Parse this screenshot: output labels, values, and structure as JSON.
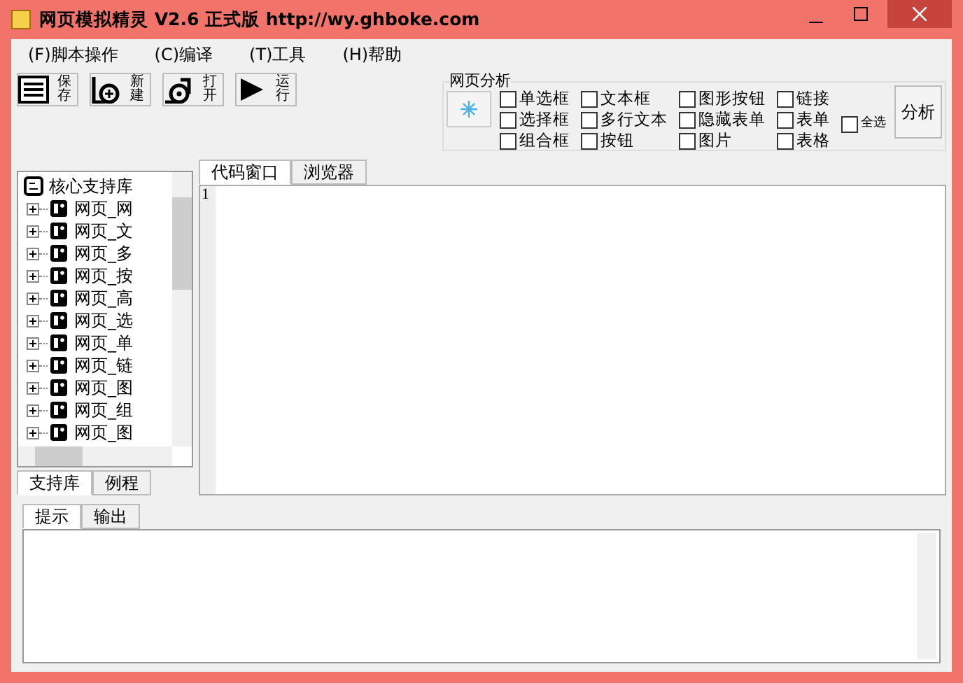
{
  "window": {
    "title": "网页模拟精灵  V2.6 正式版  http://wy.ghboke.com"
  },
  "menu": [
    "(F)脚本操作",
    "(C)编译",
    "(T)工具",
    "(H)帮助"
  ],
  "toolbar": [
    {
      "kind": "save",
      "label": "保存"
    },
    {
      "kind": "new",
      "label": "新建"
    },
    {
      "kind": "open",
      "label": "打开"
    },
    {
      "kind": "run",
      "label": "运行"
    }
  ],
  "analysis": {
    "title": "网页分析",
    "checkboxes": [
      {
        "label": "单选框",
        "checked": false
      },
      {
        "label": "选择框",
        "checked": false
      },
      {
        "label": "组合框",
        "checked": false
      },
      {
        "label": "文本框",
        "checked": false
      },
      {
        "label": "多行文本",
        "checked": false
      },
      {
        "label": "按钮",
        "checked": false
      },
      {
        "label": "图形按钮",
        "checked": false
      },
      {
        "label": "隐藏表单",
        "checked": false
      },
      {
        "label": "图片",
        "checked": false
      },
      {
        "label": "链接",
        "checked": false
      },
      {
        "label": "表单",
        "checked": false
      },
      {
        "label": "表格",
        "checked": false
      }
    ],
    "select_all": {
      "label": "全选",
      "checked": false
    },
    "button": "分析"
  },
  "library": {
    "root": "核心支持库",
    "items": [
      "网页_网",
      "网页_文",
      "网页_多",
      "网页_按",
      "网页_高",
      "网页_选",
      "网页_单",
      "网页_链",
      "网页_图",
      "网页_组",
      "网页_图"
    ]
  },
  "left_tabs": [
    {
      "label": "支持库",
      "selected": true
    },
    {
      "label": "例程",
      "selected": false
    }
  ],
  "editor_tabs": [
    {
      "label": "代码窗口",
      "selected": true
    },
    {
      "label": "浏览器",
      "selected": false
    }
  ],
  "editor": {
    "line_numbers": [
      "1"
    ]
  },
  "bottom_tabs": [
    {
      "label": "提示",
      "selected": true
    },
    {
      "label": "输出",
      "selected": false
    }
  ]
}
